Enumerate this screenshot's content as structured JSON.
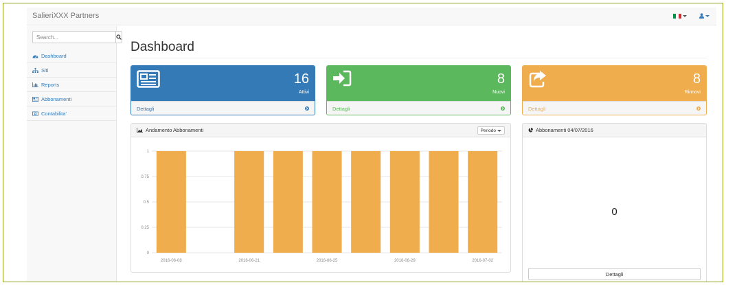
{
  "navbar": {
    "brand": "SalieriXXX Partners"
  },
  "flag_colors": [
    "#009246",
    "#ffffff",
    "#ce2b37"
  ],
  "sidebar": {
    "search": {
      "placeholder": "Search...",
      "value": ""
    },
    "items": [
      {
        "label": "Dashboard",
        "icon": "dashboard-icon"
      },
      {
        "label": "Siti",
        "icon": "sitemap-icon"
      },
      {
        "label": "Reports",
        "icon": "bar-chart-icon"
      },
      {
        "label": "Abbonamenti",
        "icon": "newspaper-icon"
      },
      {
        "label": "Contabilita'",
        "icon": "money-icon"
      }
    ]
  },
  "main": {
    "title": "Dashboard",
    "stats": [
      {
        "number": "16",
        "label": "Attivi",
        "footer": "Dettagli",
        "icon": "newspaper-icon",
        "color": "#337ab7"
      },
      {
        "number": "8",
        "label": "Nuovi",
        "footer": "Dettagli",
        "icon": "sign-in-icon",
        "color": "#5cb85c"
      },
      {
        "number": "8",
        "label": "Rinnovi",
        "footer": "Dettagli",
        "icon": "share-icon",
        "color": "#f0ad4e"
      }
    ],
    "chart_panel": {
      "title": "Andamento Abbonamenti",
      "period_label": "Periodo"
    },
    "pie_panel": {
      "title": "Abbonamenti 04/07/2016",
      "value": "0",
      "button": "Dettagli"
    }
  },
  "chart_data": {
    "type": "bar",
    "x": [
      "2016-06-08",
      "2016-06-09",
      "2016-06-21",
      "2016-06-23",
      "2016-06-25",
      "2016-06-27",
      "2016-06-29",
      "2016-07-01",
      "2016-07-02"
    ],
    "values": [
      1,
      0,
      1,
      1,
      1,
      1,
      1,
      1,
      1
    ],
    "tick_labels": [
      "2016-06-08",
      "2016-06-21",
      "2016-06-25",
      "2016-06-29",
      "2016-07-02"
    ],
    "yticks": [
      "0",
      "0.25",
      "0.5",
      "0.75",
      "1"
    ],
    "ylim": [
      0,
      1
    ],
    "color": "#f0ad4e",
    "grid": true
  }
}
